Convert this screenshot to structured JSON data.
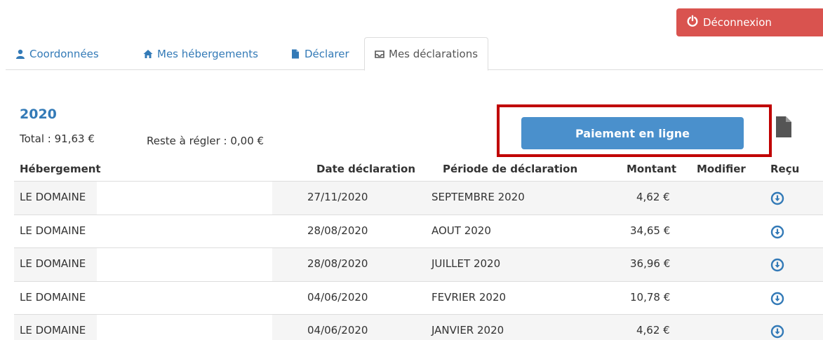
{
  "header": {
    "logout_label": "Déconnexion",
    "logout_icon": "power-icon",
    "logout_color": "#d9534f"
  },
  "tabs": [
    {
      "label": "Coordonnées",
      "icon": "user-icon",
      "active": false
    },
    {
      "label": "Mes hébergements",
      "icon": "home-icon",
      "active": false
    },
    {
      "label": "Déclarer",
      "icon": "file-icon",
      "active": false
    },
    {
      "label": "Mes déclarations",
      "icon": "inbox-icon",
      "active": true
    }
  ],
  "summary": {
    "year": "2020",
    "total": "Total : 91,63 €",
    "reste": "Reste à régler : 0,00 €"
  },
  "payment": {
    "button_label": "Paiement en ligne",
    "button_color": "#4a90cc",
    "highlight_color": "#c00000"
  },
  "table": {
    "headers": {
      "hebergement": "Hébergement",
      "date": "Date déclaration",
      "periode": "Période de déclaration",
      "montant": "Montant",
      "modifier": "Modifier",
      "recu": "Reçu"
    },
    "rows": [
      {
        "hebergement": "LE DOMAINE",
        "date": "27/11/2020",
        "periode": "SEPTEMBRE 2020",
        "montant": "4,62 €"
      },
      {
        "hebergement": "LE DOMAINE",
        "date": "28/08/2020",
        "periode": "AOUT 2020",
        "montant": "34,65 €"
      },
      {
        "hebergement": "LE DOMAINE",
        "date": "28/08/2020",
        "periode": "JUILLET 2020",
        "montant": "36,96 €"
      },
      {
        "hebergement": "LE DOMAINE",
        "date": "04/06/2020",
        "periode": "FEVRIER 2020",
        "montant": "10,78 €"
      },
      {
        "hebergement": "LE DOMAINE",
        "date": "04/06/2020",
        "periode": "JANVIER 2020",
        "montant": "4,62 €"
      }
    ]
  }
}
